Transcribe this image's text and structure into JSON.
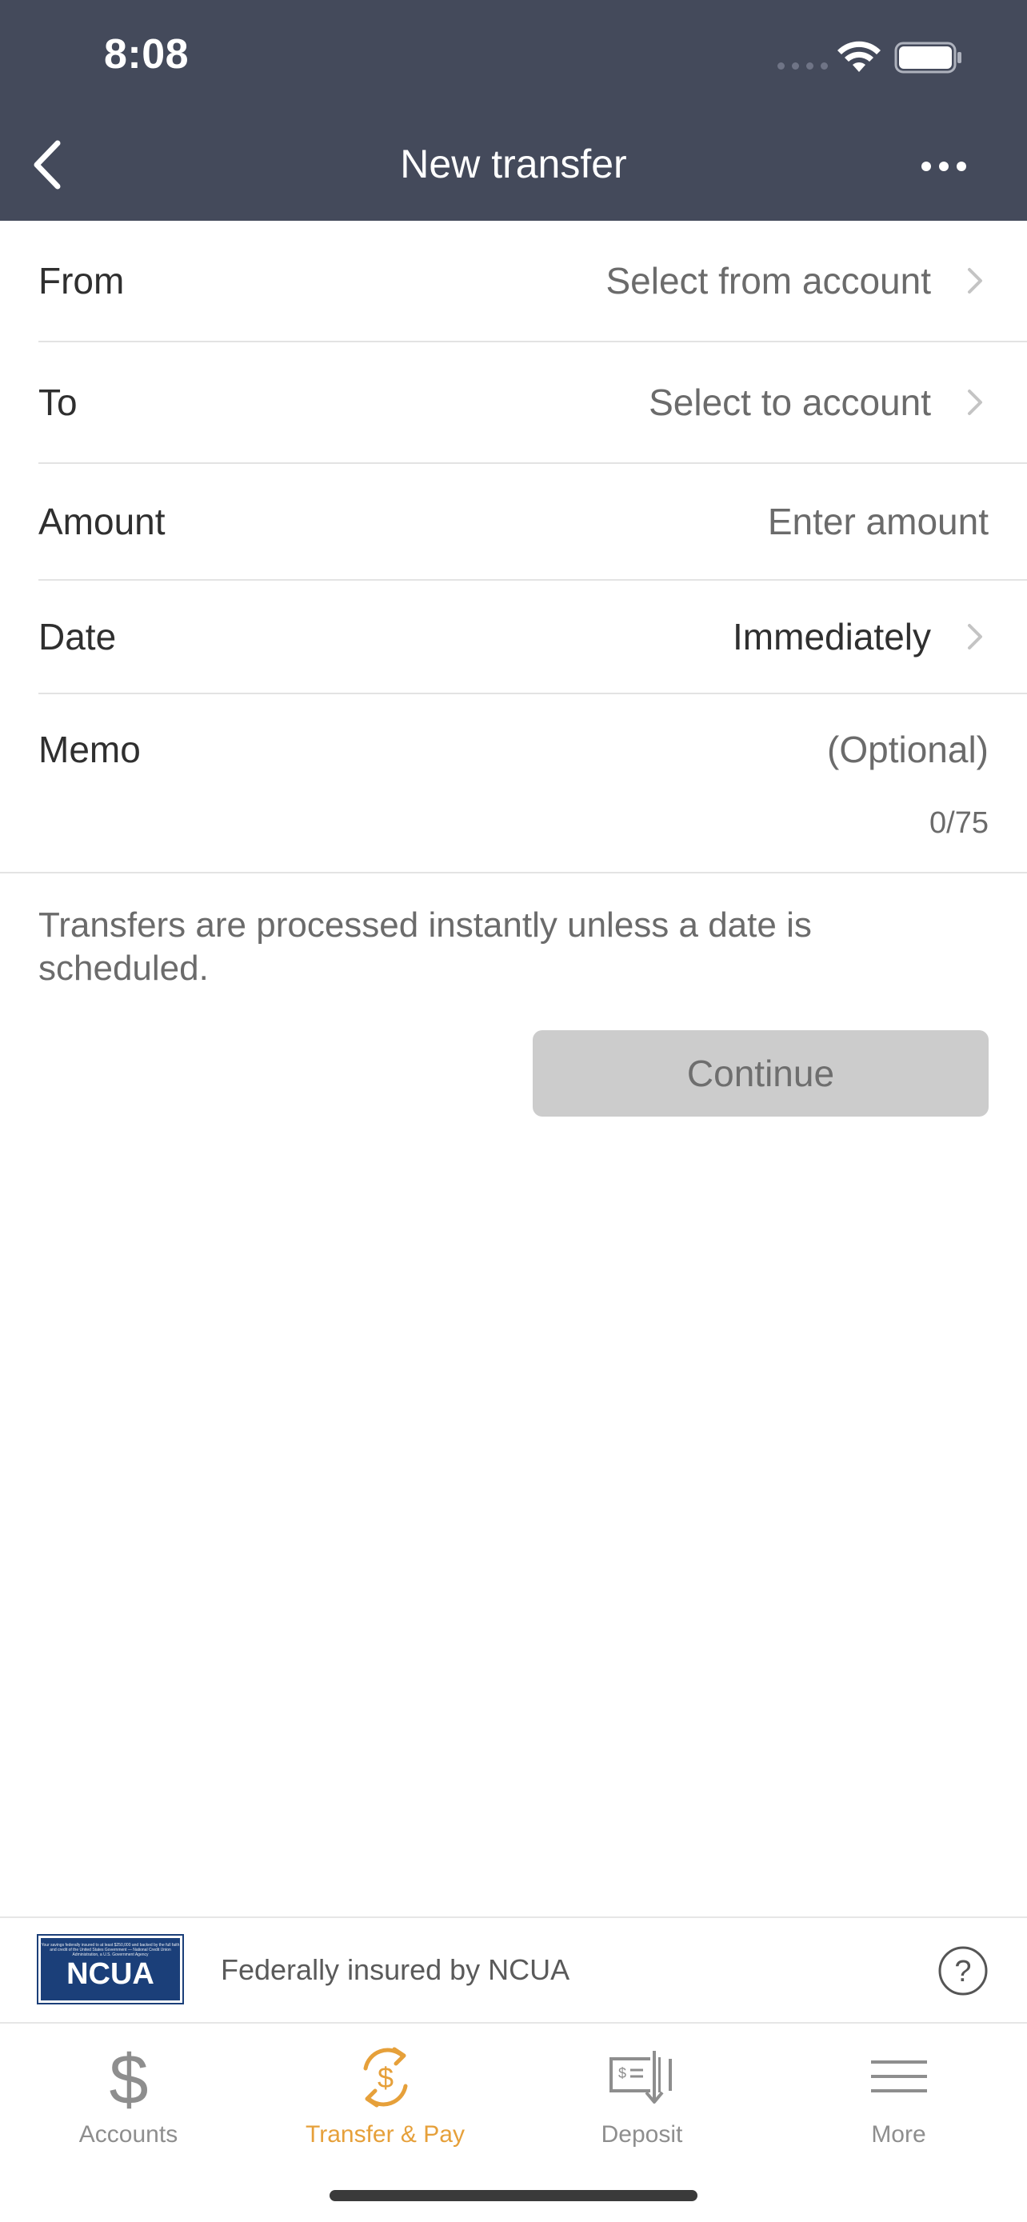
{
  "status_bar": {
    "time": "8:08"
  },
  "header": {
    "title": "New transfer"
  },
  "form": {
    "from": {
      "label": "From",
      "value": "Select from account"
    },
    "to": {
      "label": "To",
      "value": "Select to account"
    },
    "amount": {
      "label": "Amount",
      "placeholder": "Enter amount"
    },
    "date": {
      "label": "Date",
      "value": "Immediately"
    },
    "memo": {
      "label": "Memo",
      "placeholder": "(Optional)",
      "counter": "0/75"
    }
  },
  "info_text": "Transfers are processed instantly unless a date is scheduled.",
  "continue_label": "Continue",
  "ncua": {
    "logo_text": "NCUA",
    "logo_fine_print": "Your savings federally insured to at least $250,000 and backed by the full faith and credit of the United States Government — National Credit Union Administration, a U.S. Government Agency",
    "text": "Federally insured by NCUA"
  },
  "tabs": [
    {
      "label": "Accounts",
      "icon": "dollar-icon",
      "active": false
    },
    {
      "label": "Transfer & Pay",
      "icon": "transfer-pay-icon",
      "active": true
    },
    {
      "label": "Deposit",
      "icon": "check-deposit-icon",
      "active": false
    },
    {
      "label": "More",
      "icon": "hamburger-menu-icon",
      "active": false
    }
  ],
  "colors": {
    "header_bg": "#444a5b",
    "accent": "#e6a03a",
    "button_disabled": "#cccccc",
    "ncua_blue": "#1b3f79"
  }
}
